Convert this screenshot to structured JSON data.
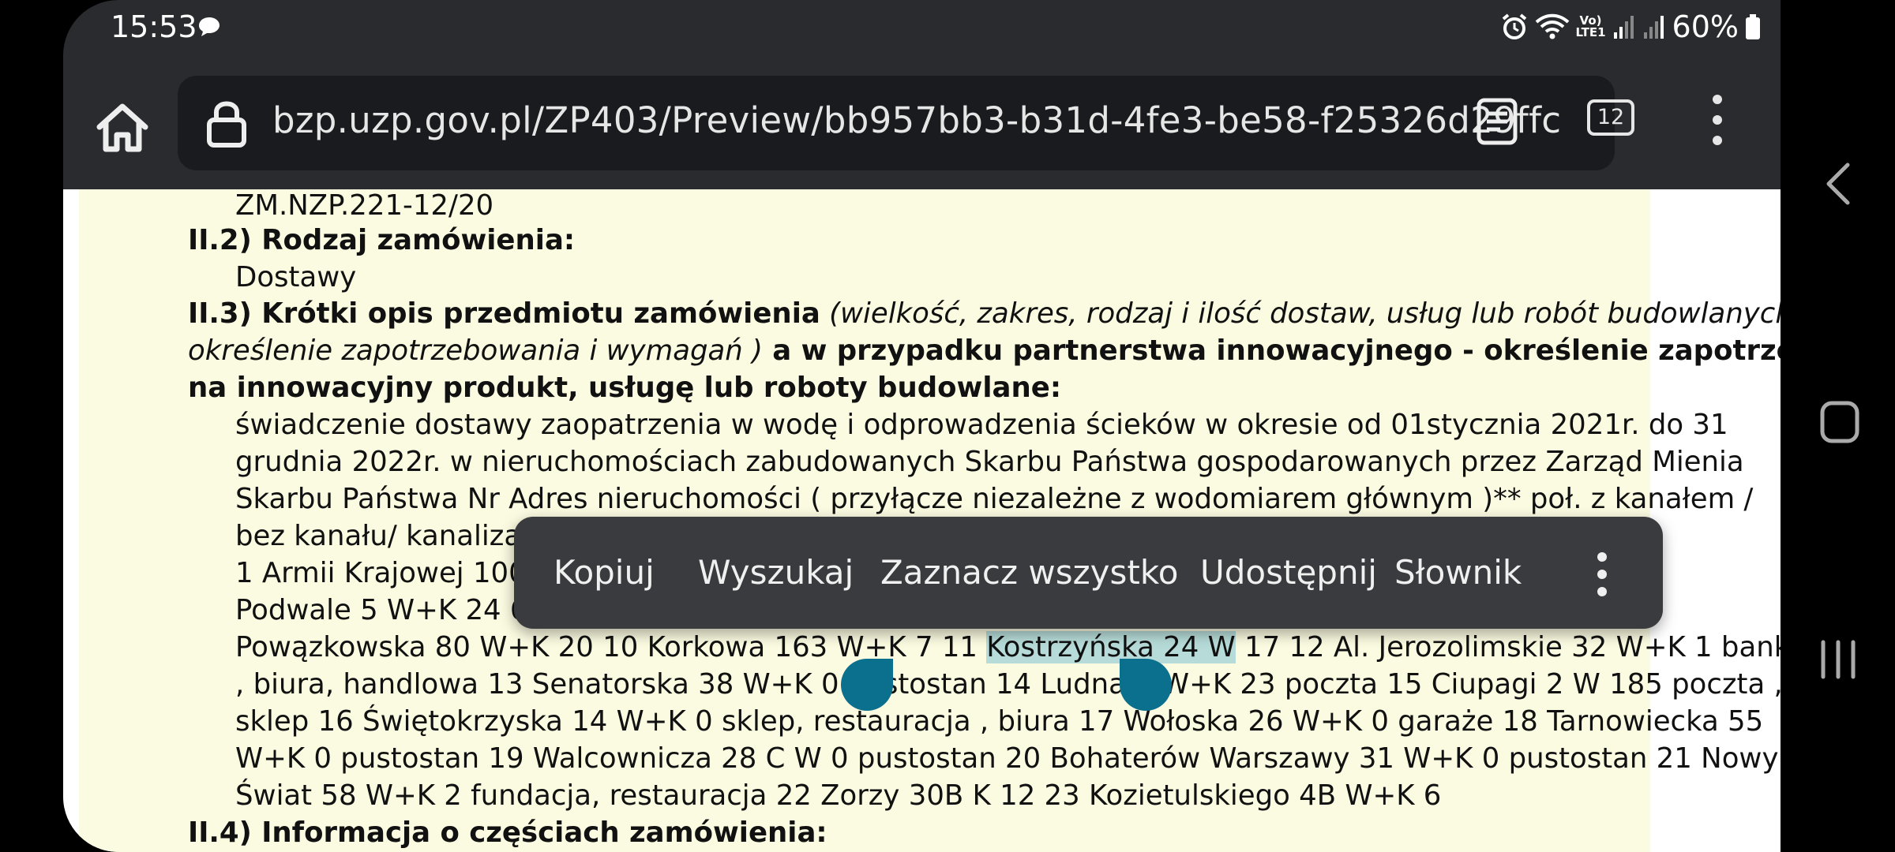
{
  "status_bar": {
    "time": "15:53",
    "network_label": "Vo) LTE1",
    "battery": "60%"
  },
  "toolbar": {
    "url": "bzp.uzp.gov.pl/ZP403/Preview/bb957bb3-b31d-4fe3-be58-f25326d29ffc",
    "tab_count": "12"
  },
  "document": {
    "ref_number": "ZM.NZP.221-12/20",
    "s22_heading": "II.2) Rodzaj zamówienia:",
    "s22_value": "Dostawy",
    "s23_bold": "II.3) Krótki opis przedmiotu zamówienia",
    "s23_italic_a": " (wielkość, zakres, rodzaj i ilość dostaw, usług lub robót budowlanych lub",
    "s23_italic_b": "określenie zapotrzebowania i wymagań )",
    "s23_bold_b": " a w przypadku partnerstwa innowacyjnego - określenie zapotrzebowania",
    "s23_bold_c": "na innowacyjny produkt, usługę lub roboty budowlane:",
    "body_1": "świadczenie dostawy zaopatrzenia w wodę i odprowadzenia ścieków w okresie od 01stycznia 2021r. do 31",
    "body_2": "grudnia 2022r. w nieruchomościach zabudowanych Skarbu Państwa gospodarowanych przez Zarząd Mienia",
    "body_3": "Skarbu Państwa Nr Adres nieruchomości ( przyłącze niezależne z wodomiarem głównym )** poł. z kanałem /",
    "body_4": "bez kanału/ kanalizacja",
    "body_5": "1 Armii Krajowej 100 W",
    "body_6": "Podwale 5 W+K 24 6 Ra",
    "body_7a": "Powązkowska 80 W+K 20 10 Korkowa 163 W+K 7 11 ",
    "body_7_sel": "Kostrzyńska 24 W",
    "body_7b": " 17 12 Al. Jerozolimskie 32 W+K 1 bank",
    "body_8": ", biura, handlowa 13 Senatorska 38 W+K 0 pustostan 14 Ludna 4 W+K 23 poczta 15 Ciupagi 2 W 185 poczta ,",
    "body_9": "sklep 16 Świętokrzyska 14 W+K 0 sklep, restauracja , biura 17 Wołoska 26 W+K 0 garaże 18 Tarnowiecka 55",
    "body_10": "W+K 0 pustostan 19 Walcownicza 28 C W 0 pustostan 20 Bohaterów Warszawy 31 W+K 0 pustostan 21 Nowy",
    "body_11": "Świat 58 W+K 2 fundacja, restauracja 22 Zorzy 30B K 12 23 Kozietulskiego 4B W+K 6",
    "s24_heading": "II.4) Informacja o częściach zamówienia:"
  },
  "context_menu": {
    "copy": "Kopiuj",
    "search": "Wyszukaj",
    "select_all": "Zaznacz wszystko",
    "share": "Udostępnij",
    "dictionary": "Słownik"
  },
  "colors": {
    "doc_background": "#fbfbe1",
    "selection": "#b6dbd8",
    "handle": "#0b6f8e",
    "toolbar": "#2a2b2f"
  }
}
